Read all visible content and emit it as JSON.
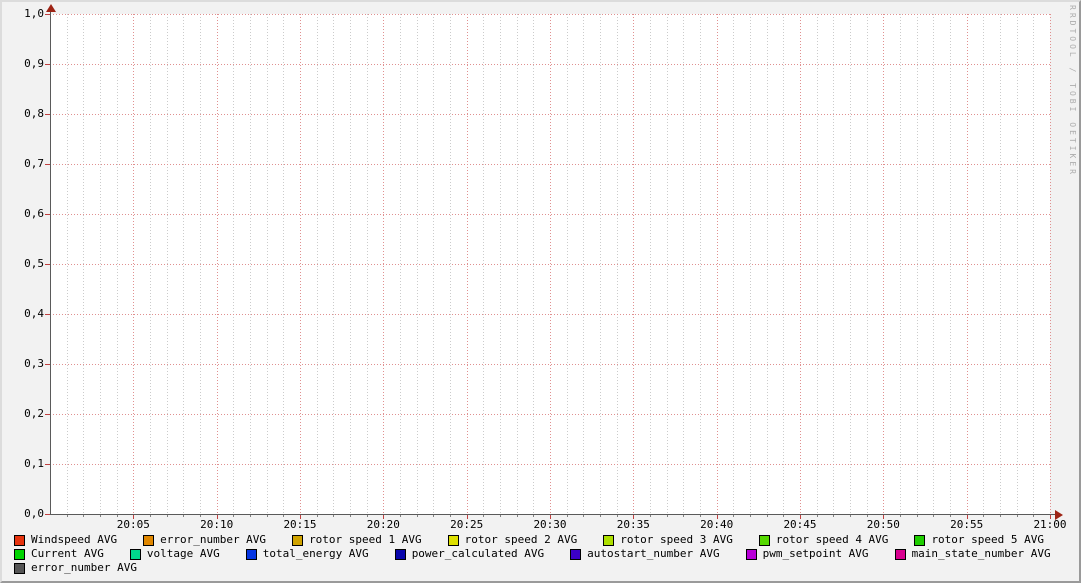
{
  "watermark": "RRDTOOL / TOBI OETIKER",
  "colors": {
    "background": "#F2F2F2",
    "canvas": "#FFFFFF",
    "major_grid": "#E09090",
    "minor_grid": "#CBCBCB",
    "axis": "#5A5A5A",
    "arrow": "#9E2415",
    "tick_major": "#C04040",
    "watermark": "#ADADAD"
  },
  "chart_data": {
    "type": "line",
    "title": "",
    "xlabel": "",
    "ylabel": "",
    "x_axis": {
      "start": "20:00",
      "end": "21:00",
      "tick_labels": [
        "20:05",
        "20:10",
        "20:15",
        "20:20",
        "20:25",
        "20:30",
        "20:35",
        "20:40",
        "20:45",
        "20:50",
        "20:55",
        "21:00"
      ],
      "major_tick_interval_minutes": 5,
      "minor_tick_interval_minutes": 1
    },
    "y_axis": {
      "min": 0.0,
      "max": 1.0,
      "tick_labels": [
        "1,0",
        "0,9",
        "0,8",
        "0,7",
        "0,6",
        "0,5",
        "0,4",
        "0,3",
        "0,2",
        "0,1",
        "0,0"
      ],
      "decimal_separator": ","
    },
    "grid": true,
    "legend_position": "bottom",
    "data_points": "none visible (empty canvas, no series lines drawn)",
    "series": [
      {
        "name": "Windspeed AVG",
        "color": "#E7340F",
        "values": []
      },
      {
        "name": "error_number AVG",
        "color": "#E08700",
        "values": []
      },
      {
        "name": "rotor speed 1 AVG",
        "color": "#D0A300",
        "values": []
      },
      {
        "name": "rotor speed 2 AVG",
        "color": "#DEE000",
        "values": []
      },
      {
        "name": "rotor speed 3 AVG",
        "color": "#AEE000",
        "values": []
      },
      {
        "name": "rotor speed 4 AVG",
        "color": "#55D800",
        "values": []
      },
      {
        "name": "rotor speed 5 AVG",
        "color": "#1FCE00",
        "values": []
      },
      {
        "name": "Current AVG",
        "color": "#00D400",
        "values": []
      },
      {
        "name": "voltage AVG",
        "color": "#00D98C",
        "values": []
      },
      {
        "name": "total_energy AVG",
        "color": "#0636E3",
        "values": []
      },
      {
        "name": "power_calculated AVG",
        "color": "#0805AC",
        "values": []
      },
      {
        "name": "autostart_number AVG",
        "color": "#3C00C8",
        "values": []
      },
      {
        "name": "pwm_setpoint AVG",
        "color": "#B800D8",
        "values": []
      },
      {
        "name": "main_state_number AVG",
        "color": "#D8008F",
        "values": []
      },
      {
        "name": "error_number AVG",
        "color": "#555555",
        "values": []
      }
    ]
  },
  "legend": {
    "rows": [
      [
        0,
        1,
        2,
        3,
        4,
        5,
        6
      ],
      [
        7,
        8,
        9,
        10,
        11,
        12,
        13
      ],
      [
        14
      ]
    ]
  }
}
